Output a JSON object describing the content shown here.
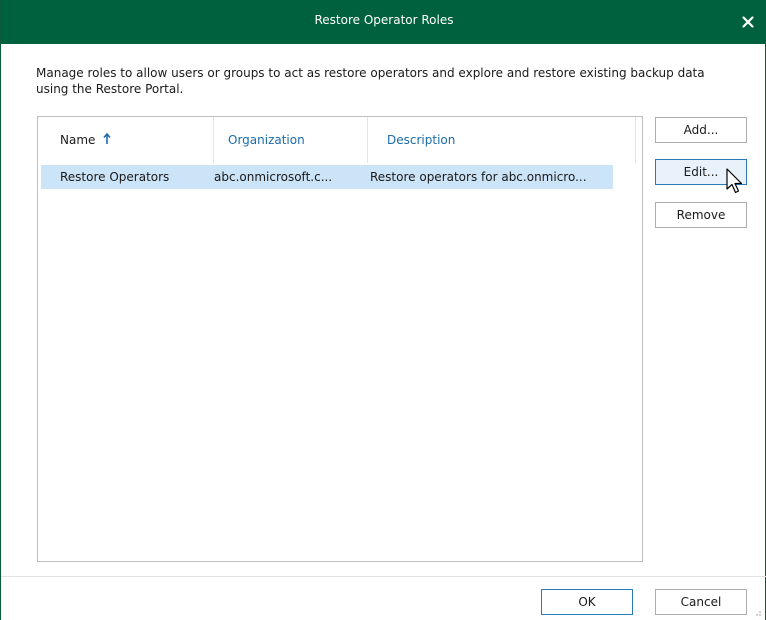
{
  "window": {
    "title": "Restore Operator Roles"
  },
  "description": "Manage roles to allow users or groups to act as restore operators and explore and restore existing backup data using the Restore Portal.",
  "table": {
    "columns": [
      {
        "label": "Name",
        "sorted": "ascending"
      },
      {
        "label": "Organization"
      },
      {
        "label": "Description"
      }
    ],
    "rows": [
      {
        "name": "Restore Operators",
        "organization": "abc.onmicrosoft.c...",
        "description": "Restore operators for abc.onmicro...",
        "selected": true
      }
    ]
  },
  "buttons": {
    "add": "Add...",
    "edit": "Edit...",
    "remove": "Remove",
    "ok": "OK",
    "cancel": "Cancel"
  },
  "colors": {
    "titlebar": "#00613f",
    "selection": "#cce4f7",
    "link_header": "#1b6ca8",
    "sort_arrow": "#1b6ca8"
  },
  "icons": {
    "close": "close-icon",
    "sort": "sort-ascending-icon",
    "cursor": "mouse-pointer-icon"
  }
}
